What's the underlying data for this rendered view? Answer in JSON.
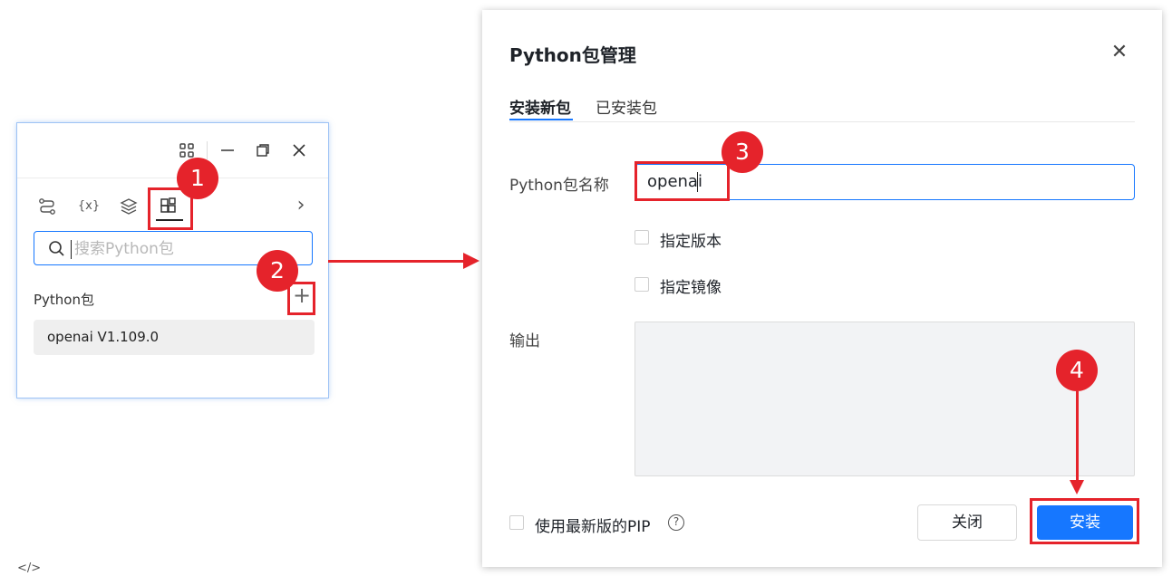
{
  "left_panel": {
    "window_controls": {
      "minimize": "—",
      "restore": "❐",
      "close": "✕"
    },
    "toolbar_icons": [
      "flow-icon",
      "variable-icon",
      "layers-icon",
      "packages-icon"
    ],
    "variable_icon_text": "{x}",
    "more": "›",
    "search": {
      "placeholder": "搜索Python包"
    },
    "section_label": "Python包",
    "add_label": "+",
    "packages": [
      {
        "label": "openai V1.109.0"
      }
    ]
  },
  "steps": [
    "1",
    "2",
    "3",
    "4"
  ],
  "dialog": {
    "title": "Python包管理",
    "close_label": "✕",
    "tabs": [
      {
        "label": "安装新包",
        "active": true
      },
      {
        "label": "已安装包",
        "active": false
      }
    ],
    "name_label": "Python包名称",
    "name_value": "openai",
    "options": [
      {
        "label": "指定版本",
        "checked": false
      },
      {
        "label": "指定镜像",
        "checked": false
      }
    ],
    "output_label": "输出",
    "output_value": "",
    "pip_option": {
      "label": "使用最新版的PIP",
      "checked": false
    },
    "help_label": "?",
    "close_button": "关闭",
    "install_button": "安装"
  },
  "footer": {
    "code_icon": "</>"
  },
  "colors": {
    "accent": "#1677ff",
    "annotation_red": "#e5232b"
  }
}
